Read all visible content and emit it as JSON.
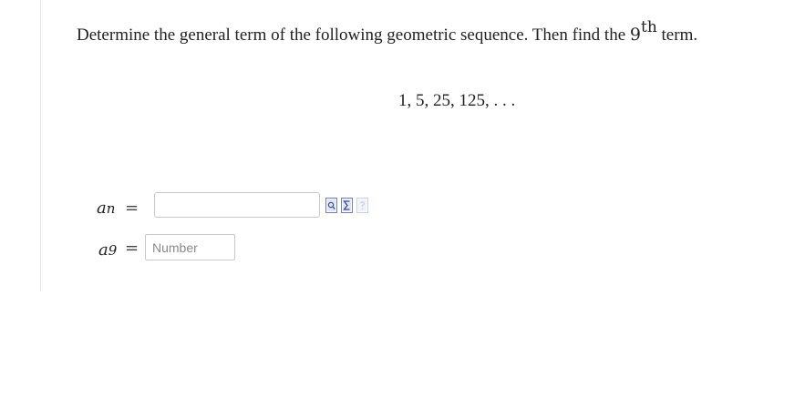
{
  "question": {
    "text_before": "Determine the general term of the following geometric sequence. Then find the ",
    "ordinal_number": "9",
    "ordinal_suffix": "th",
    "text_after": " term."
  },
  "sequence": "1, 5, 25, 125, . . .",
  "general_term": {
    "variable": "a",
    "subscript": "n",
    "equals": "=",
    "value": ""
  },
  "ninth_term": {
    "variable": "a",
    "subscript": "9",
    "equals": "=",
    "value": "",
    "placeholder": "Number"
  },
  "tools": [
    {
      "name": "preview-icon"
    },
    {
      "name": "equation-editor-icon"
    },
    {
      "name": "help-icon"
    }
  ],
  "colors": {
    "tool_icon": "#6f7fb8",
    "tool_icon_disabled": "#c7d0ea"
  }
}
